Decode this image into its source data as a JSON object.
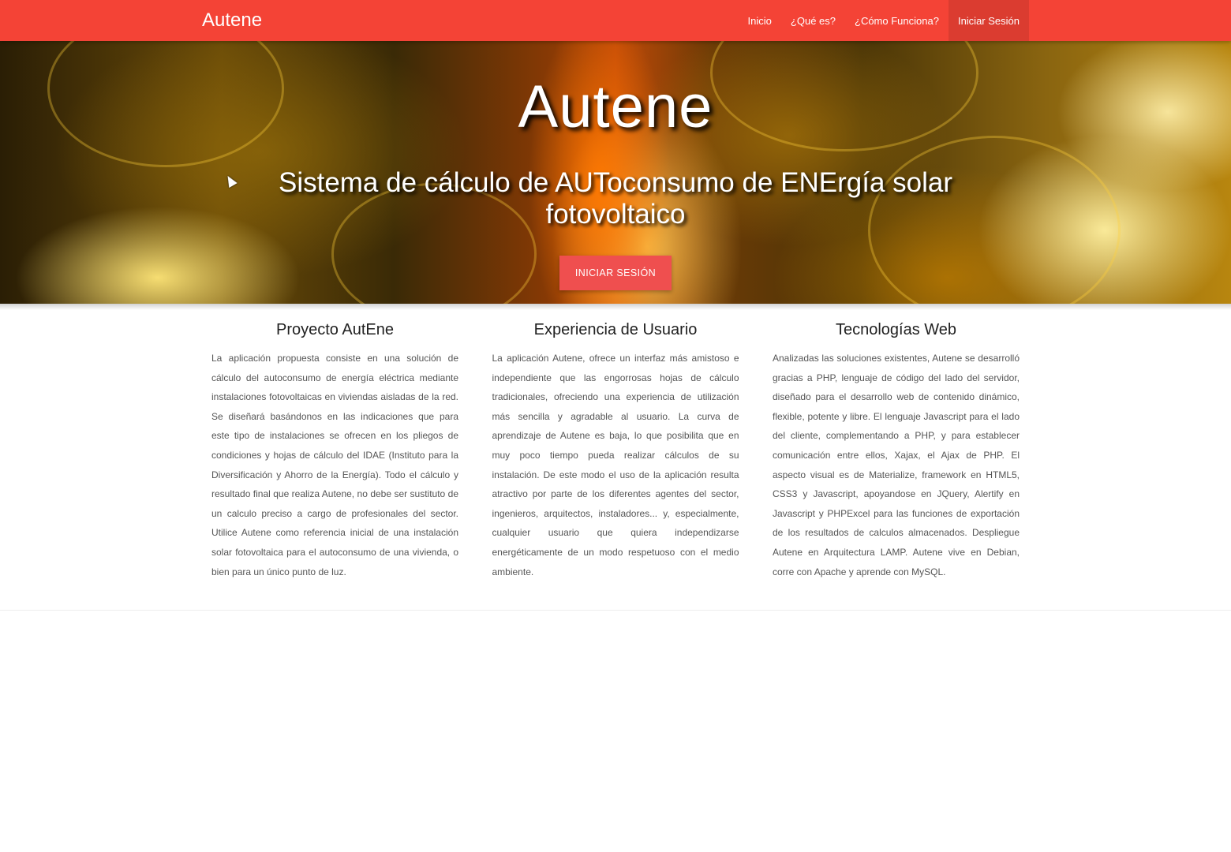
{
  "navbar": {
    "brand": "Autene",
    "links": [
      {
        "label": "Inicio"
      },
      {
        "label": "¿Qué es?"
      },
      {
        "label": "¿Cómo Funciona?"
      },
      {
        "label": "Iniciar Sesión"
      }
    ],
    "color": "#f44336"
  },
  "hero": {
    "title": "Autene",
    "subtitle": "Sistema de cálculo de AUToconsumo de ENErgía solar fotovoltaico",
    "button_label": "Iniciar Sesión"
  },
  "features": [
    {
      "heading": "Proyecto AutEne",
      "text": "La aplicación propuesta consiste en una solución de cálculo del autoconsumo de energía eléctrica mediante instalaciones fotovoltaicas en viviendas aisladas de la red. Se diseñará basándonos en las indicaciones que para este tipo de instalaciones se ofrecen en los pliegos de condiciones y hojas de cálculo del IDAE (Instituto para la Diversificación y Ahorro de la Energía). Todo el cálculo y resultado final que realiza Autene, no debe ser sustituto de un calculo preciso a cargo de profesionales del sector. Utilice Autene como referencia inicial de una instalación solar fotovoltaica para el autoconsumo de una vivienda, o bien para un único punto de luz."
    },
    {
      "heading": "Experiencia de Usuario",
      "text": "La aplicación Autene, ofrece un interfaz más amistoso e independiente que las engorrosas hojas de cálculo tradicionales, ofreciendo una experiencia de utilización más sencilla y agradable al usuario. La curva de aprendizaje de Autene es baja, lo que posibilita que en muy poco tiempo pueda realizar cálculos de su instalación. De este modo el uso de la aplicación resulta atractivo por parte de los diferentes agentes del sector, ingenieros, arquitectos, instaladores... y, especialmente, cualquier usuario que quiera independizarse energéticamente de un modo respetuoso con el medio ambiente."
    },
    {
      "heading": "Tecnologías Web",
      "text": "Analizadas las soluciones existentes, Autene se desarrolló gracias a PHP, lenguaje de código del lado del servidor, diseñado para el desarrollo web de contenido dinámico, flexible, potente y libre. El lenguaje Javascript para el lado del cliente, complementando a PHP, y para establecer comunicación entre ellos, Xajax, el Ajax de PHP. El aspecto visual es de Materialize, framework en HTML5, CSS3 y Javascript, apoyandose en JQuery, Alertify en Javascript y PHPExcel para las funciones de exportación de los resultados de calculos almacenados. Despliegue Autene en Arquitectura LAMP. Autene vive en Debian, corre con Apache y aprende con MySQL."
    }
  ]
}
